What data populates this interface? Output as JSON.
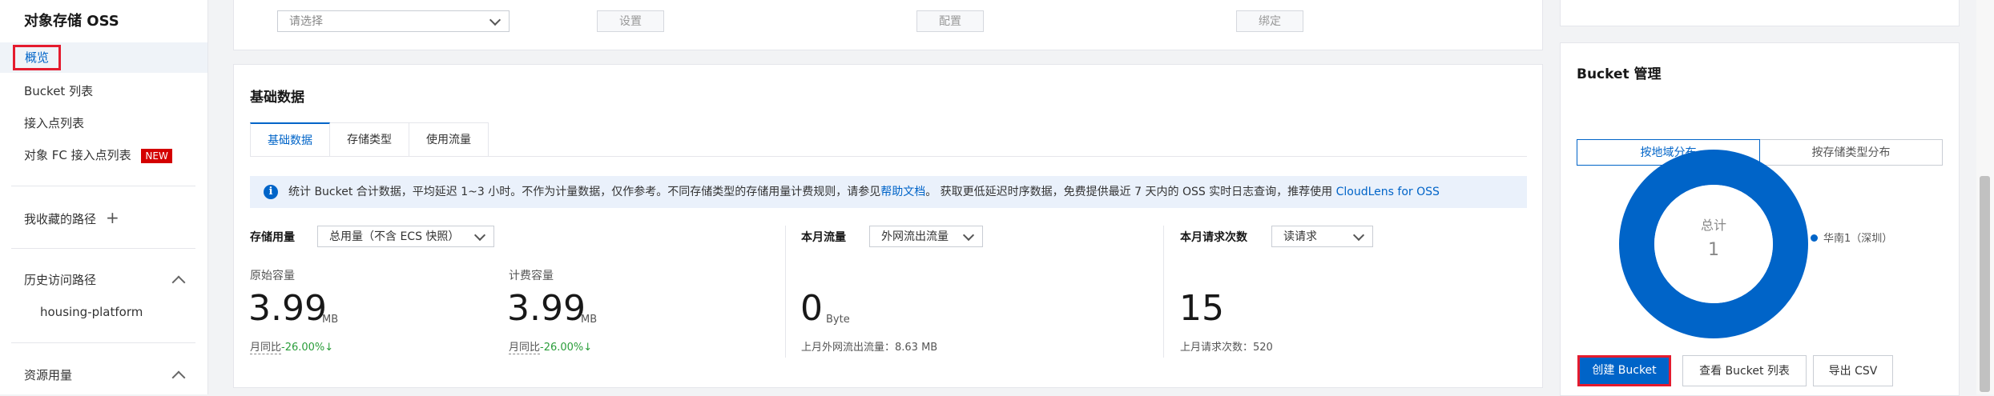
{
  "sidebar": {
    "title": "对象存储 OSS",
    "items": [
      {
        "label": "概览"
      },
      {
        "label": "Bucket 列表"
      },
      {
        "label": "接入点列表"
      },
      {
        "label": "对象 FC 接入点列表",
        "badge": "NEW"
      }
    ],
    "favorites_label": "我收藏的路径",
    "favorites_add_icon": "plus-icon",
    "history_label": "历史访问路径",
    "history_items": [
      "housing-platform"
    ],
    "resource_label": "资源用量"
  },
  "top_row": {
    "select_placeholder": "请选择",
    "buttons": [
      "设置",
      "配置",
      "绑定"
    ]
  },
  "basic_data": {
    "title": "基础数据",
    "tabs": [
      "基础数据",
      "存储类型",
      "使用流量"
    ],
    "active_tab": 0,
    "info": {
      "text_before": "统计 Bucket 合计数据，平均延迟 1~3 小时。不作为计量数据，仅作参考。不同存储类型的存储用量计费规则，请参见",
      "link1": "帮助文档",
      "text_mid": "。 获取更低延迟时序数据，免费提供最近 7 天内的 OSS 实时日志查询，推荐使用",
      "link2": "CloudLens for OSS"
    },
    "storage": {
      "label": "存储用量",
      "select": "总用量（不含 ECS 快照）",
      "original": {
        "label": "原始容量",
        "value": "3.99",
        "unit": "MB",
        "trend_label": "月同比",
        "trend_value": "-26.00%",
        "trend_arrow": "↓"
      },
      "billing": {
        "label": "计费容量",
        "value": "3.99",
        "unit": "MB",
        "trend_label": "月同比",
        "trend_value": "-26.00%",
        "trend_arrow": "↓"
      }
    },
    "traffic": {
      "label": "本月流量",
      "select": "外网流出流量",
      "value": "0",
      "unit": "Byte",
      "last_month": "上月外网流出流量：8.63 MB"
    },
    "requests": {
      "label": "本月请求次数",
      "select": "读请求",
      "value": "15",
      "last_month": "上月请求次数：520"
    }
  },
  "bucket_mgmt": {
    "title": "Bucket 管理",
    "segments": [
      "按地域分布",
      "按存储类型分布"
    ],
    "active_segment": 0,
    "donut_total_label": "总计",
    "donut_total_value": "1",
    "legend": [
      {
        "name": "华南1（深圳）",
        "color": "#0064c8",
        "value": 1
      }
    ],
    "buttons": {
      "create": "创建 Bucket",
      "list": "查看 Bucket 列表",
      "export": "导出 CSV"
    }
  },
  "colors": {
    "accent": "#0064c8",
    "highlight_border": "#e41b2e",
    "new_badge": "#d40000",
    "trend_down": "#2a9d3a"
  }
}
